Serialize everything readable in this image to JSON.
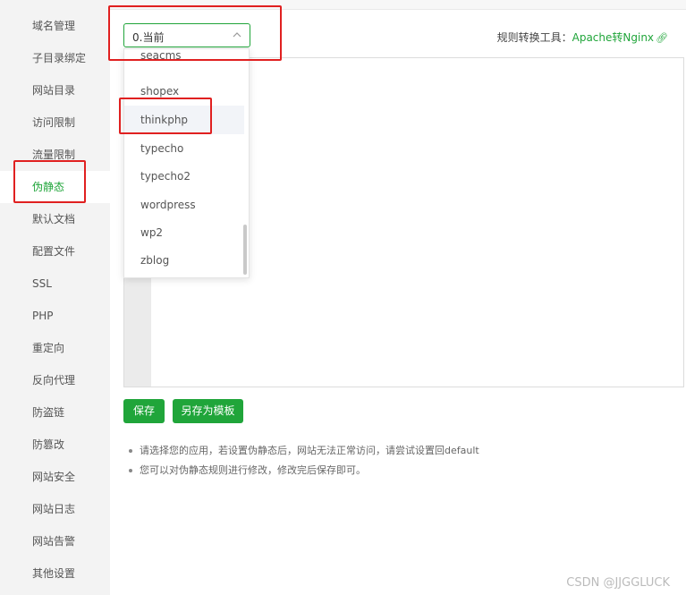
{
  "sidebar": {
    "items": [
      {
        "label": "域名管理"
      },
      {
        "label": "子目录绑定"
      },
      {
        "label": "网站目录"
      },
      {
        "label": "访问限制"
      },
      {
        "label": "流量限制"
      },
      {
        "label": "伪静态",
        "active": true
      },
      {
        "label": "默认文档"
      },
      {
        "label": "配置文件"
      },
      {
        "label": "SSL"
      },
      {
        "label": "PHP"
      },
      {
        "label": "重定向"
      },
      {
        "label": "反向代理"
      },
      {
        "label": "防盗链"
      },
      {
        "label": "防篡改"
      },
      {
        "label": "网站安全"
      },
      {
        "label": "网站日志"
      },
      {
        "label": "网站告警"
      },
      {
        "label": "其他设置"
      }
    ]
  },
  "rewrite": {
    "select_value": "0.当前",
    "dropdown_options": [
      "seacms",
      "shopex",
      "thinkphp",
      "typecho",
      "typecho2",
      "wordpress",
      "wp2",
      "zblog"
    ],
    "highlighted_option": "thinkphp",
    "tool_label": "规则转换工具：",
    "tool_link": "Apache转Nginx",
    "save_button": "保存",
    "save_template_button": "另存为模板",
    "tips": [
      "请选择您的应用，若设置伪静态后，网站无法正常访问，请尝试设置回default",
      "您可以对伪静态规则进行修改，修改完后保存即可。"
    ]
  },
  "watermark": "CSDN @JJGGLUCK",
  "colors": {
    "accent": "#20a53a",
    "annotation": "#e02020",
    "sidebar_bg": "#f3f3f3"
  },
  "icons": {
    "select_chevron": "chevron-up-icon",
    "tool_link_icon": "link-icon"
  }
}
